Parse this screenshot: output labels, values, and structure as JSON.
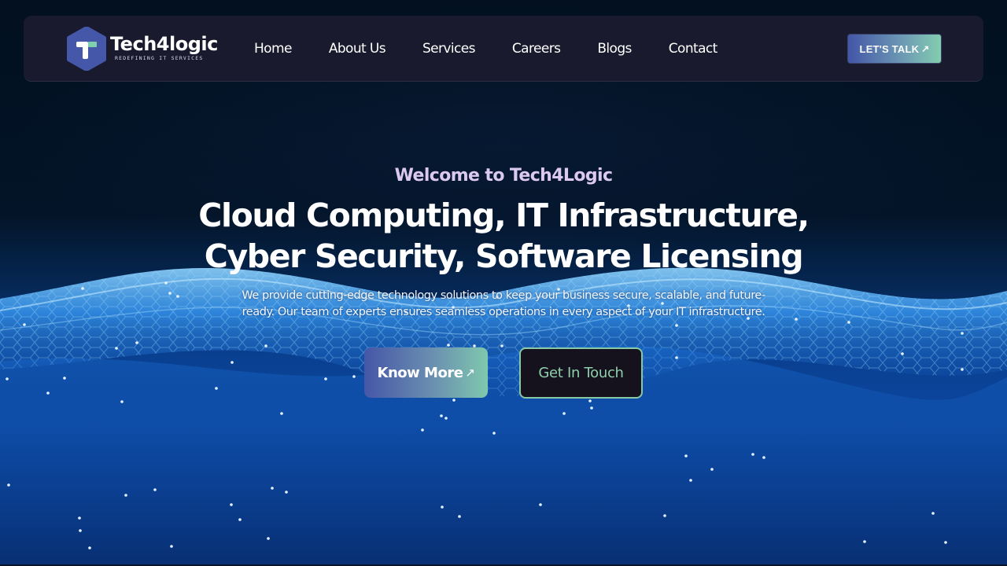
{
  "brand": {
    "name": "Tech4logic",
    "tagline": "REDEFINING IT SERVICES",
    "logo_icon": "hexagon-t-logo-icon",
    "colors": {
      "hex_blue": "#4457a8",
      "accent_green": "#7fcfae",
      "nav_bg": "#1a1a2e"
    }
  },
  "nav": {
    "links": [
      {
        "label": "Home"
      },
      {
        "label": "About Us"
      },
      {
        "label": "Services"
      },
      {
        "label": "Careers"
      },
      {
        "label": "Blogs"
      },
      {
        "label": "Contact"
      }
    ],
    "cta": {
      "label": "LET'S TALK",
      "icon": "arrow-up-right-icon",
      "glyph": "↗"
    }
  },
  "hero": {
    "eyebrow": "Welcome to Tech4Logic",
    "headline_line1": "Cloud Computing, IT Infrastructure,",
    "headline_line2": "Cyber Security, Software Licensing",
    "description_line1": "We provide cutting-edge technology solutions to keep your business secure, scalable, and future-",
    "description_line2": "ready. Our team of experts ensures seamless operations in every aspect of your IT infrastructure.",
    "primary_button": {
      "label": "Know More",
      "icon": "arrow-up-right-icon",
      "glyph": "↗"
    },
    "secondary_button": {
      "label": "Get In Touch"
    },
    "colors": {
      "eyebrow": "#dcc9f2",
      "secondary_text": "#8ed0ab",
      "secondary_border": "#86c9a4"
    }
  }
}
